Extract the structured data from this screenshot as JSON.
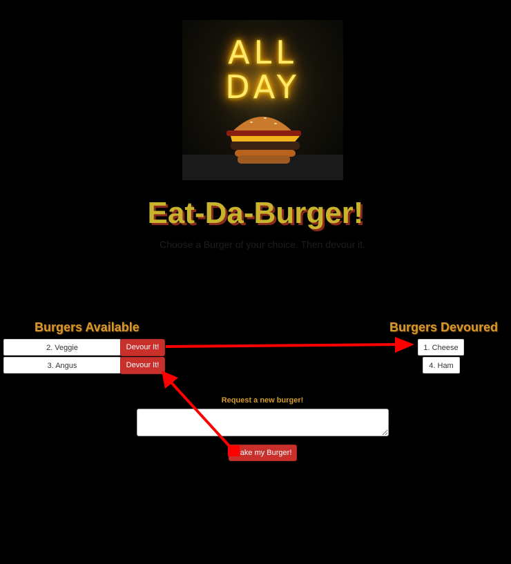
{
  "hero": {
    "neon_line1": "ALL",
    "neon_line2": "DAY",
    "image_icon": "burger-image"
  },
  "header": {
    "title": "Eat-Da-Burger!",
    "subtitle": "Choose a Burger of your choice. Then devour it."
  },
  "available": {
    "heading": "Burgers Available",
    "items": [
      {
        "label": "2. Veggie",
        "button": "Devour It!"
      },
      {
        "label": "3. Angus",
        "button": "Devour It!"
      }
    ]
  },
  "devoured": {
    "heading": "Burgers Devoured",
    "items": [
      {
        "label": "1. Cheese"
      },
      {
        "label": "4. Ham"
      }
    ]
  },
  "form": {
    "label": "Request a new burger!",
    "input_value": "",
    "submit": "Make my Burger!"
  },
  "colors": {
    "background": "#000000",
    "title": "#c7b32c",
    "title_shadow": "#8a2a1c",
    "heading": "#d59a2a",
    "button": "#c9302c",
    "annotation_arrow": "#ff0000"
  }
}
